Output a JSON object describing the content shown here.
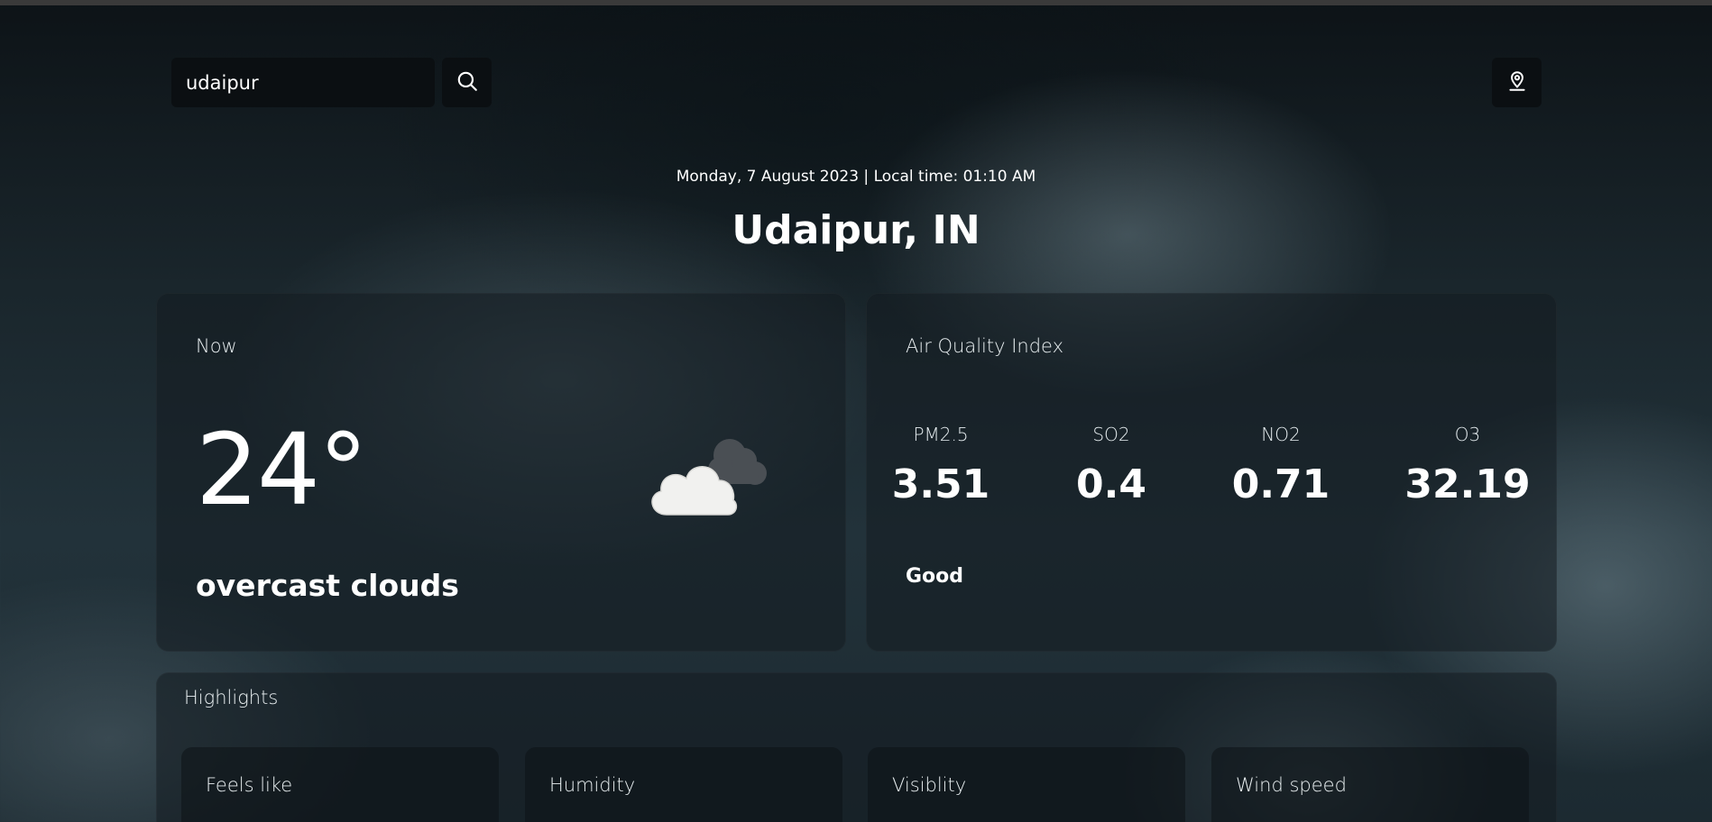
{
  "search": {
    "value": "udaipur"
  },
  "header": {
    "date_line": "Monday, 7 August 2023 | Local time: 01:10 AM",
    "city": "Udaipur, IN"
  },
  "now": {
    "title": "Now",
    "temperature": "24°",
    "description": "overcast clouds",
    "icon": "overcast-cloud-icon"
  },
  "aqi": {
    "title": "Air Quality Index",
    "pollutants": [
      {
        "label": "PM2.5",
        "value": "3.51"
      },
      {
        "label": "SO2",
        "value": "0.4"
      },
      {
        "label": "NO2",
        "value": "0.71"
      },
      {
        "label": "O3",
        "value": "32.19"
      }
    ],
    "status": "Good"
  },
  "highlights": {
    "title": "Highlights",
    "items": [
      {
        "label": "Feels like"
      },
      {
        "label": "Humidity"
      },
      {
        "label": "Visiblity"
      },
      {
        "label": "Wind speed"
      }
    ]
  },
  "icons": {
    "search": "search-icon",
    "location": "location-pin-icon"
  }
}
